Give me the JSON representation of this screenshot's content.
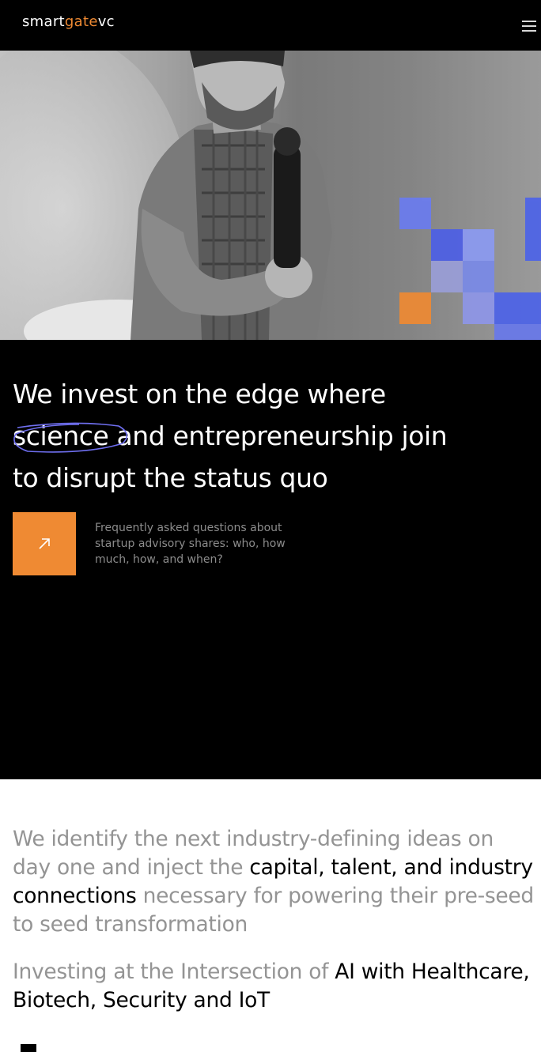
{
  "header": {
    "logo": {
      "part1": "smart",
      "part2": "gate",
      "part3": "vc"
    },
    "menu_icon": "hamburger-icon"
  },
  "hero": {
    "image": "speaker-with-microphone-photo",
    "accent_colors": [
      "#4d63e8",
      "#6f80f0",
      "#ef8a33"
    ]
  },
  "intro": {
    "headline_part1": "We invest on the edge where",
    "headline_circled": "science",
    "headline_part2": "and entrepreneurship join",
    "headline_part3": "to disrupt the status quo",
    "cta_icon": "arrow-up-right-icon",
    "faq_text": "Frequently asked questions about startup advisory shares: who, how much, how, and when?"
  },
  "mission": {
    "p1_grey1": "We identify the next industry-defining ideas on day one and inject the",
    "p1_black": "capital, talent, and industry connections",
    "p1_grey2": "necessary for powering their pre-seed to seed transformation",
    "p2_grey": "Investing at the Intersection of",
    "p2_black": "AI with Healthcare, Biotech, Security and IoT"
  },
  "colors": {
    "accent": "#ef8a33",
    "background": "#000000",
    "muted_text": "#949494"
  }
}
